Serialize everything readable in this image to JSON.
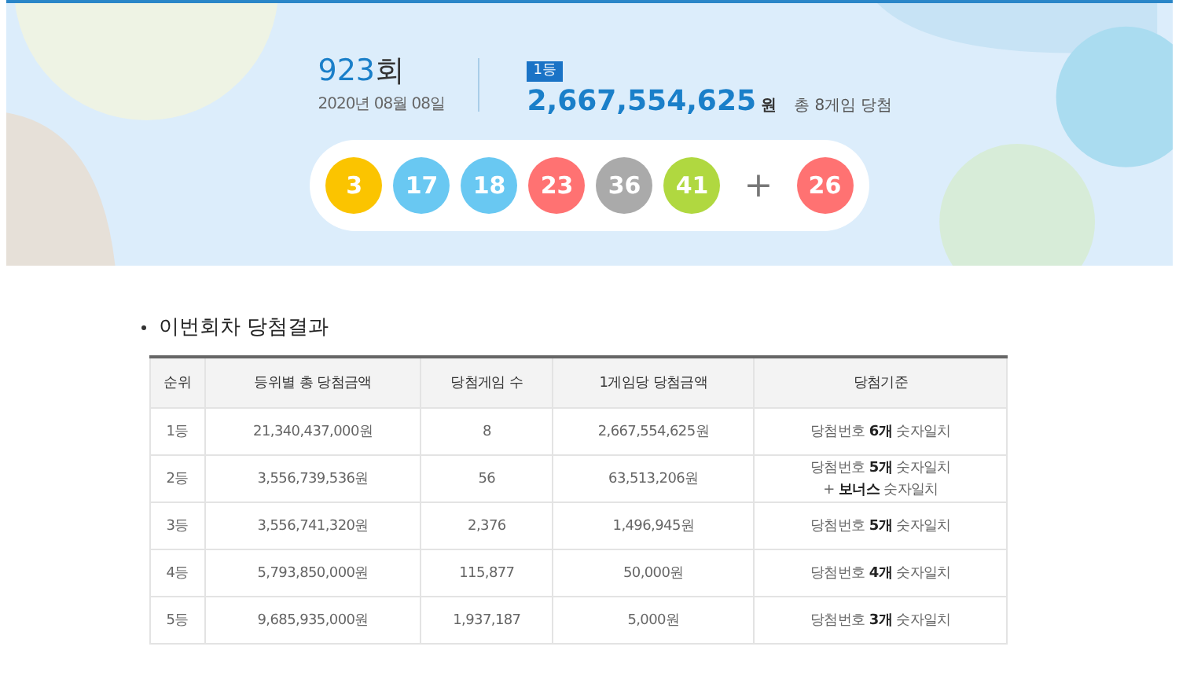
{
  "draw": {
    "round": "923",
    "round_suffix": "회",
    "date": "2020년 08월 08일",
    "rank_badge": "1등",
    "prize": "2,667,554,625",
    "prize_unit": "원",
    "winners": "총 8게임 당첨",
    "numbers": [
      {
        "value": "3",
        "color": "#fbc400"
      },
      {
        "value": "17",
        "color": "#69c8f2"
      },
      {
        "value": "18",
        "color": "#69c8f2"
      },
      {
        "value": "23",
        "color": "#ff7272"
      },
      {
        "value": "36",
        "color": "#aaaaaa"
      },
      {
        "value": "41",
        "color": "#b0d840"
      }
    ],
    "plus": "+",
    "bonus": {
      "value": "26",
      "color": "#ff7272"
    }
  },
  "section_title": "이번회차 당첨결과",
  "table": {
    "columns": [
      "순위",
      "등위별 총 당첨금액",
      "당첨게임 수",
      "1게임당 당첨금액",
      "당첨기준"
    ],
    "rows": [
      [
        "1등",
        "21,340,437,000원",
        "8",
        "2,667,554,625원",
        [
          "당첨번호 **6개** 숫자일치"
        ]
      ],
      [
        "2등",
        "3,556,739,536원",
        "56",
        "63,513,206원",
        [
          "당첨번호 **5개** 숫자일치",
          "+ **보너스** 숫자일치"
        ]
      ],
      [
        "3등",
        "3,556,741,320원",
        "2,376",
        "1,496,945원",
        [
          "당첨번호 **5개** 숫자일치"
        ]
      ],
      [
        "4등",
        "5,793,850,000원",
        "115,877",
        "50,000원",
        [
          "당첨번호 **4개** 숫자일치"
        ]
      ],
      [
        "5등",
        "9,685,935,000원",
        "1,937,187",
        "5,000원",
        [
          "당첨번호 **3개** 숫자일치"
        ]
      ]
    ]
  }
}
